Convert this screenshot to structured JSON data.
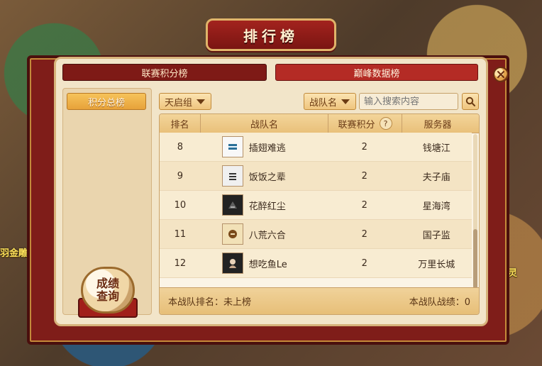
{
  "dialog": {
    "title": "排行榜"
  },
  "tabs": {
    "league_points": "联赛积分榜",
    "peak_data": "巅峰数据榜"
  },
  "sidebar": {
    "total_points": "积分总榜"
  },
  "filters": {
    "group": "天启组",
    "search_type": "战队名",
    "search_placeholder": "输入搜索内容"
  },
  "table": {
    "headers": [
      "排名",
      "战队名",
      "联赛积分",
      "服务器"
    ],
    "rows": [
      {
        "rank": "8",
        "team": "插翅难逃",
        "points": "2",
        "server": "钱塘江",
        "avatar": "light"
      },
      {
        "rank": "9",
        "team": "饭饭之辈",
        "points": "2",
        "server": "夫子庙",
        "avatar": "stamp"
      },
      {
        "rank": "10",
        "team": "花醉红尘",
        "points": "2",
        "server": "星海湾",
        "avatar": "dark"
      },
      {
        "rank": "11",
        "team": "八荒六合",
        "points": "2",
        "server": "国子监",
        "avatar": "gold"
      },
      {
        "rank": "12",
        "team": "想吃鱼Le",
        "points": "2",
        "server": "万里长城",
        "avatar": "dark"
      }
    ],
    "footer": {
      "my_rank": "本战队排名：未上榜",
      "my_record": "本战队战绩：0"
    },
    "help_symbol": "?"
  },
  "buttons": {
    "query_line1": "成绩",
    "query_line2": "查询"
  },
  "background_labels": {
    "left": "羽金雕",
    "right": "衣之灵"
  },
  "icons": {
    "search": "search-icon",
    "close": "close-icon",
    "dropdown": "chevron-down-icon",
    "help": "question-icon"
  },
  "colors": {
    "frame_red": "#7f1d19",
    "tab_active": "#b42b25",
    "panel_bg": "#f2e5c9",
    "accent_gold": "#efc57e"
  }
}
